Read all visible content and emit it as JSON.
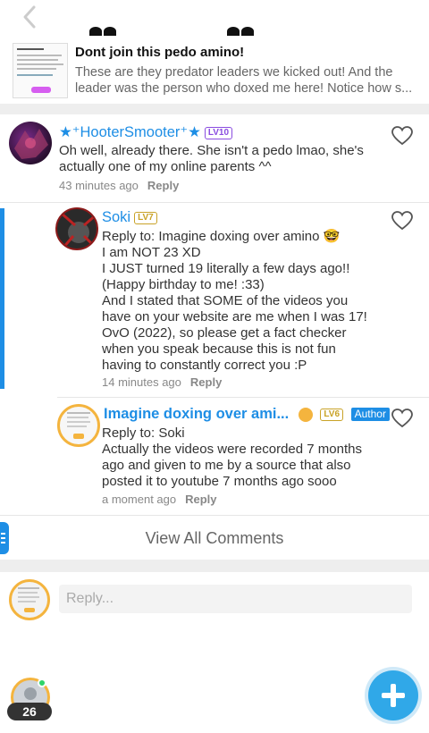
{
  "colors": {
    "accent": "#1e8ee5",
    "gold": "#f4b43e",
    "fab": "#30a8e8"
  },
  "post": {
    "title": "Dont join this pedo amino!",
    "desc_line1": "These are they predator leaders we kicked out! And the",
    "desc_line2": "leader was the person who doxed me here! Notice how s..."
  },
  "comments": [
    {
      "author": "★⁺HooterSmooter⁺★",
      "level": "LV10",
      "lines": [
        "Oh well, already there. She isn't a pedo lmao, she's",
        "actually one of my online parents ^^"
      ],
      "time": "43 minutes ago",
      "reply_label": "Reply"
    },
    {
      "author": "Soki",
      "level": "LV7",
      "lines": [
        "Reply to: Imagine doxing over amino 🤓",
        "I am NOT 23 XD",
        "I JUST turned 19 literally a few days ago!!",
        "(Happy birthday to me! :33)",
        "And I stated that SOME of the videos you",
        "have on your website are me when I was 17!",
        "OvO (2022), so please get a fact checker",
        "when you speak because this is not fun",
        "having to constantly correct you :P"
      ],
      "time": "14 minutes ago",
      "reply_label": "Reply"
    },
    {
      "author": "Imagine doxing over ami...",
      "level": "LV6",
      "author_tag": "Author",
      "lines": [
        "Reply to: Soki",
        "Actually the videos were recorded 7 months",
        "ago and given to me by a source that also",
        "posted it to youtube 7 months ago sooo"
      ],
      "time": "a moment ago",
      "reply_label": "Reply"
    }
  ],
  "view_all": "View All Comments",
  "reply_box": {
    "placeholder": "Reply..."
  },
  "me": {
    "count": "26"
  }
}
